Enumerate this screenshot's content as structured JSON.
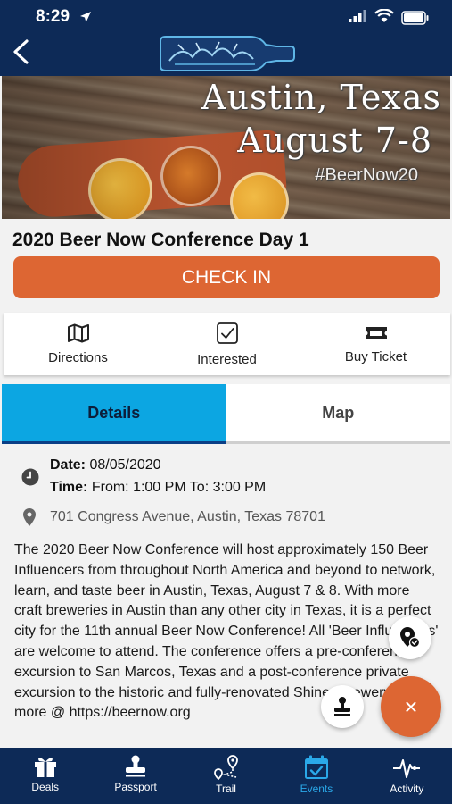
{
  "status_bar": {
    "time": "8:29"
  },
  "hero": {
    "line1": "Austin, Texas",
    "line2": "August 7-8",
    "hashtag": "#BeerNow20"
  },
  "event": {
    "title": "2020 Beer Now Conference Day 1",
    "checkin_label": "CHECK IN",
    "date_label": "Date:",
    "date_value": "08/05/2020",
    "time_label": "Time:",
    "time_value": "From: 1:00 PM To: 3:00 PM",
    "address": "701 Congress Avenue, Austin, Texas 78701",
    "description": "The 2020 Beer Now Conference will host approximately 150 Beer Influencers from throughout North America and beyond to network, learn, and taste beer in Austin, Texas, August 7 & 8. With more craft breweries in Austin than any other city in Texas, it is a perfect city for the 11th annual Beer Now Conference! All 'Beer Influencers' are welcome to attend. The conference offers a pre-conference excursion to San Marcos, Texas and a post-conference private excursion to the historic and fully-renovated Shiner Brewery! Learn more @ https://beernow.org"
  },
  "actions": [
    {
      "label": "Directions",
      "icon": "map-icon"
    },
    {
      "label": "Interested",
      "icon": "checkbox-icon"
    },
    {
      "label": "Buy Ticket",
      "icon": "ticket-icon"
    }
  ],
  "tabs": [
    {
      "label": "Details",
      "active": true
    },
    {
      "label": "Map",
      "active": false
    }
  ],
  "fab": {
    "main_symbol": "×"
  },
  "nav": [
    {
      "label": "Deals",
      "icon": "gift-icon",
      "active": false
    },
    {
      "label": "Passport",
      "icon": "stamp-icon",
      "active": false
    },
    {
      "label": "Trail",
      "icon": "trail-icon",
      "active": false
    },
    {
      "label": "Events",
      "icon": "calendar-icon",
      "active": true
    },
    {
      "label": "Activity",
      "icon": "activity-icon",
      "active": false
    }
  ],
  "colors": {
    "header": "#0d2a57",
    "accent": "#dd6633",
    "tab_active": "#0ca6e2",
    "nav_active": "#2aa8e8"
  }
}
